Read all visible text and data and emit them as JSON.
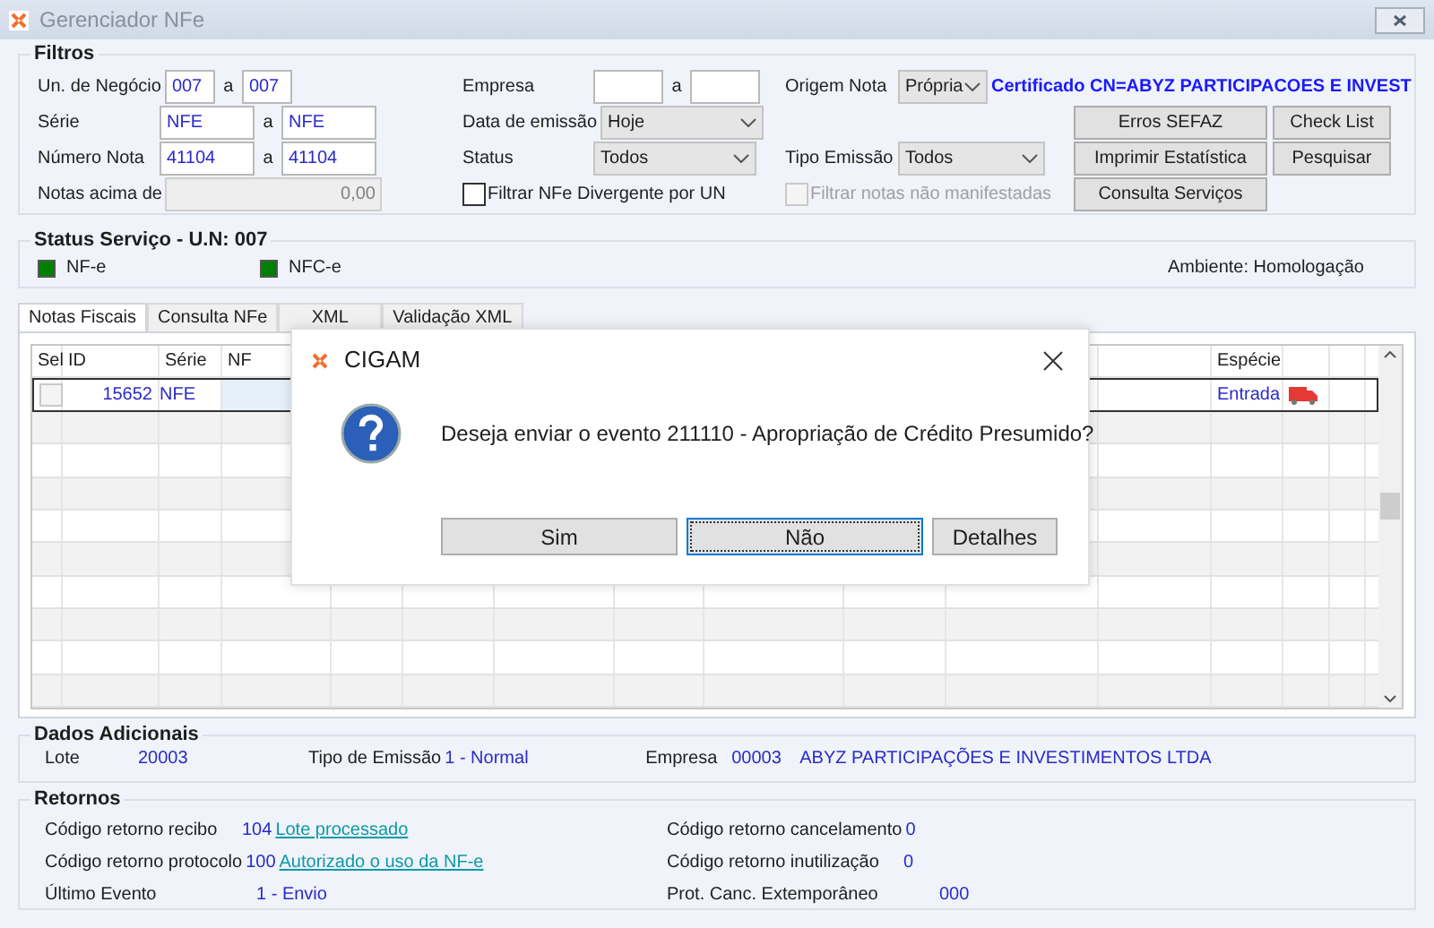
{
  "window": {
    "title": "Gerenciador NFe"
  },
  "filtros": {
    "title": "Filtros",
    "ranges": [
      {
        "label": "Un. de Negócio",
        "from": "007",
        "separator": "a",
        "to": "007"
      },
      {
        "label": "Série",
        "from": "NFE",
        "separator": "a",
        "to": "NFE"
      },
      {
        "label": "Número Nota",
        "from": "41104",
        "separator": "a",
        "to": "41104"
      }
    ],
    "notas_acima": {
      "label": "Notas acima de",
      "value": "0,00",
      "disabled": true
    },
    "empresa": {
      "label": "Empresa",
      "separator": "a"
    },
    "data_emissao": {
      "label": "Data de emissão",
      "value": "Hoje"
    },
    "status": {
      "label": "Status",
      "value": "Todos"
    },
    "divergente": {
      "label": "Filtrar NFe Divergente por UN",
      "checked": false,
      "disabled": false
    },
    "origem": {
      "label": "Origem Nota",
      "value": "Própria"
    },
    "certificado": "Certificado CN=ABYZ PARTICIPACOES E INVEST",
    "tipo_emissao": {
      "label": "Tipo Emissão",
      "value": "Todos"
    },
    "nao_manifestadas": {
      "label": "Filtrar notas não manifestadas",
      "checked": false,
      "disabled": true
    },
    "buttons": [
      [
        "Erros SEFAZ",
        "Check List"
      ],
      [
        "Imprimir Estatística",
        "Pesquisar"
      ],
      [
        "Consulta Serviços"
      ]
    ]
  },
  "status_servico": {
    "title": "Status Serviço - U.N: 007",
    "items": [
      {
        "label": "NF-e",
        "color": "#008000"
      },
      {
        "label": "NFC-e",
        "color": "#008000"
      }
    ],
    "ambiente": "Ambiente: Homologação"
  },
  "tabs": [
    {
      "label": "Notas Fiscais",
      "selected": true
    },
    {
      "label": "Consulta NFe",
      "selected": false
    },
    {
      "label": "XML",
      "selected": false
    },
    {
      "label": "Validação XML",
      "selected": false
    }
  ],
  "table": {
    "columns": [
      "Sel",
      "ID",
      "Série",
      "NF",
      "Espécie"
    ],
    "rows": [
      {
        "checked": false,
        "id": "15652",
        "serie": "NFE",
        "especie": "Entrada",
        "selected": true
      }
    ]
  },
  "dialog": {
    "title": "CIGAM",
    "message": "Deseja enviar o evento 211110 - Apropriação de Crédito Presumido?",
    "buttons": [
      {
        "label": "Sim",
        "focused": false
      },
      {
        "label": "Não",
        "focused": true
      },
      {
        "label": "Detalhes",
        "focused": false
      }
    ]
  },
  "dados_adicionais": {
    "title": "Dados Adicionais",
    "lote_label": "Lote",
    "lote": "20003",
    "tipo_label": "Tipo de Emissão",
    "tipo": "1 - Normal",
    "empresa_label": "Empresa",
    "empresa_code": "00003",
    "empresa_name": "ABYZ PARTICIPAÇÕES E INVESTIMENTOS LTDA"
  },
  "retornos": {
    "title": "Retornos",
    "left": [
      {
        "label": "Código retorno recibo",
        "code": "104",
        "link": "Lote processado"
      },
      {
        "label": "Código retorno protocolo",
        "code": "100",
        "link": "Autorizado o uso da NF-e"
      },
      {
        "label": "Último Evento",
        "code": "1 - Envio"
      }
    ],
    "right": [
      {
        "label": "Código retorno cancelamento",
        "code": "0"
      },
      {
        "label": "Código retorno inutilização",
        "code": "0"
      },
      {
        "label": "Prot. Canc. Extemporâneo",
        "code": "000"
      }
    ]
  }
}
